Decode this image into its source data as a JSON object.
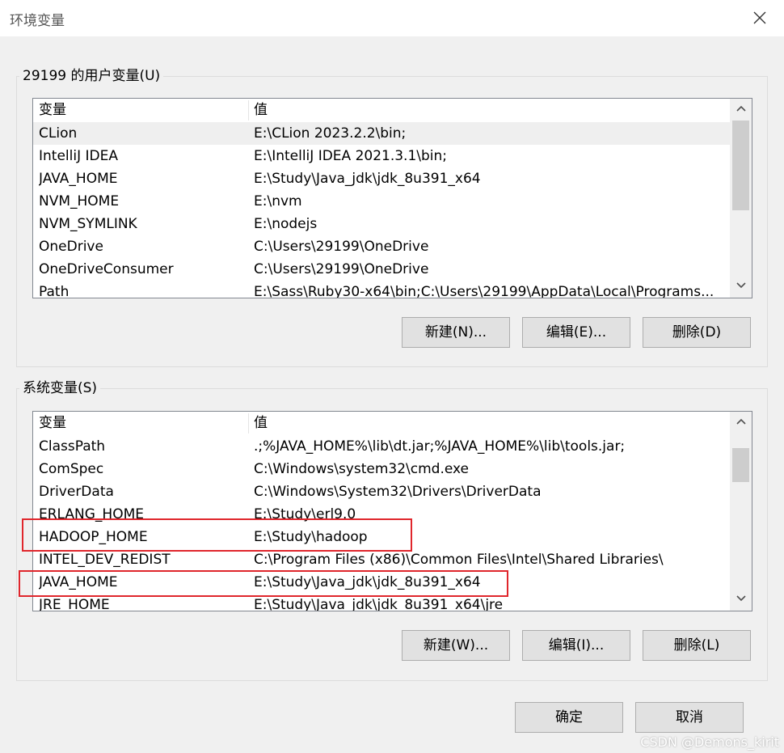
{
  "window": {
    "title": "环境变量",
    "close_icon": "close-icon"
  },
  "user_vars": {
    "group_label": "29199 的用户变量(U)",
    "header": {
      "name": "变量",
      "value": "值"
    },
    "rows": [
      {
        "name": "CLion",
        "value": "E:\\CLion 2023.2.2\\bin;",
        "selected": true
      },
      {
        "name": "IntelliJ IDEA",
        "value": "E:\\IntelliJ IDEA 2021.3.1\\bin;"
      },
      {
        "name": "JAVA_HOME",
        "value": "E:\\Study\\Java_jdk\\jdk_8u391_x64"
      },
      {
        "name": "NVM_HOME",
        "value": "E:\\nvm"
      },
      {
        "name": "NVM_SYMLINK",
        "value": "E:\\nodejs"
      },
      {
        "name": "OneDrive",
        "value": "C:\\Users\\29199\\OneDrive"
      },
      {
        "name": "OneDriveConsumer",
        "value": "C:\\Users\\29199\\OneDrive"
      },
      {
        "name": "Path",
        "value": "E:\\Sass\\Ruby30-x64\\bin;C:\\Users\\29199\\AppData\\Local\\Programs..."
      }
    ],
    "buttons": {
      "new": "新建(N)...",
      "edit": "编辑(E)...",
      "delete": "删除(D)"
    }
  },
  "system_vars": {
    "group_label": "系统变量(S)",
    "header": {
      "name": "变量",
      "value": "值"
    },
    "rows": [
      {
        "name": "ClassPath",
        "value": ".;%JAVA_HOME%\\lib\\dt.jar;%JAVA_HOME%\\lib\\tools.jar;"
      },
      {
        "name": "ComSpec",
        "value": "C:\\Windows\\system32\\cmd.exe"
      },
      {
        "name": "DriverData",
        "value": "C:\\Windows\\System32\\Drivers\\DriverData"
      },
      {
        "name": "ERLANG_HOME",
        "value": "E:\\Study\\erl9.0"
      },
      {
        "name": "HADOOP_HOME",
        "value": "E:\\Study\\hadoop",
        "highlight": true
      },
      {
        "name": "INTEL_DEV_REDIST",
        "value": "C:\\Program Files (x86)\\Common Files\\Intel\\Shared Libraries\\"
      },
      {
        "name": "JAVA_HOME",
        "value": "E:\\Study\\Java_jdk\\jdk_8u391_x64",
        "highlight": true
      },
      {
        "name": "JRE_HOME",
        "value": "E:\\Study\\Java_jdk\\jdk_8u391_x64\\jre"
      }
    ],
    "buttons": {
      "new": "新建(W)...",
      "edit": "编辑(I)...",
      "delete": "删除(L)"
    }
  },
  "footer": {
    "ok": "确定",
    "cancel": "取消"
  },
  "watermark": "CSDN @Demons_kirit",
  "colors": {
    "highlight_box": "#e0262c",
    "selected_row": "#efefef"
  }
}
